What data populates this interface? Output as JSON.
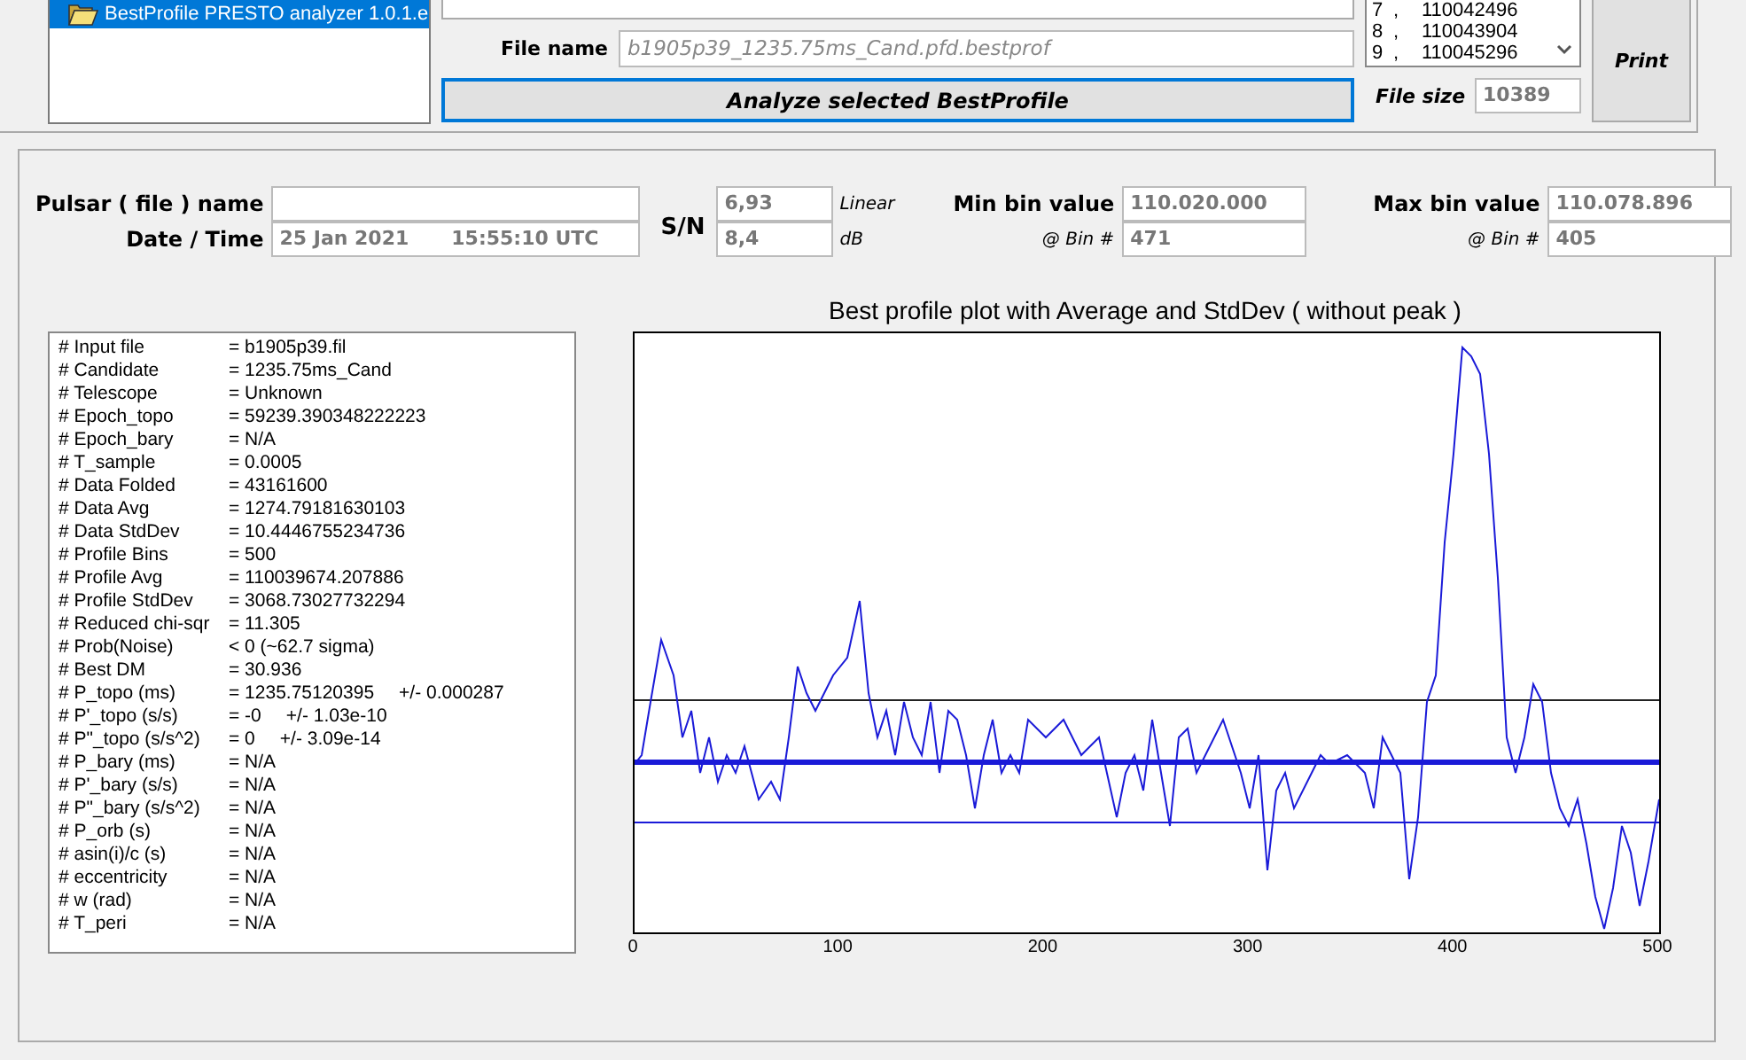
{
  "file_tree": {
    "items": [
      {
        "label": "BestProfile PRESTO analyzer 1.0.1.e",
        "selected": true
      }
    ]
  },
  "file_name": {
    "label": "File name",
    "value": "b1905p39_1235.75ms_Cand.pfd.bestprof"
  },
  "analyze_button": "Analyze selected BestProfile",
  "bin_list": {
    "rows": [
      {
        "index": "7",
        "sep": ",",
        "value": "110042496"
      },
      {
        "index": "8",
        "sep": ",",
        "value": "110043904"
      },
      {
        "index": "9",
        "sep": ",",
        "value": "110045296"
      }
    ]
  },
  "file_size": {
    "label": "File size",
    "value": "10389"
  },
  "print_button": "Print",
  "pulsar_name": {
    "label": "Pulsar ( file ) name"
  },
  "date_time": {
    "label": "Date / Time",
    "date": "25 Jan 2021",
    "time": "15:55:10  UTC"
  },
  "sn": {
    "label": "S/N",
    "linear": "6,93",
    "linear_unit": "Linear",
    "db": "8,4",
    "db_unit": "dB"
  },
  "min_bin": {
    "label": "Min bin value",
    "value": "110.020.000",
    "bin_label": "@ Bin #",
    "bin": "471"
  },
  "max_bin": {
    "label": "Max bin value",
    "value": "110.078.896",
    "bin_label": "@ Bin #",
    "bin": "405"
  },
  "header_info": [
    {
      "key": "# Input file",
      "value": "=  b1905p39.fil"
    },
    {
      "key": "# Candidate",
      "value": "=  1235.75ms_Cand"
    },
    {
      "key": "# Telescope",
      "value": "=  Unknown"
    },
    {
      "key": "# Epoch_topo",
      "value": "=  59239.390348222223"
    },
    {
      "key": "# Epoch_bary",
      "value": "=  N/A"
    },
    {
      "key": "# T_sample",
      "value": "=  0.0005"
    },
    {
      "key": "# Data Folded",
      "value": "=  43161600"
    },
    {
      "key": "# Data Avg",
      "value": "=  1274.79181630103"
    },
    {
      "key": "# Data StdDev",
      "value": "=  10.4446755234736"
    },
    {
      "key": "# Profile Bins",
      "value": "=  500"
    },
    {
      "key": "# Profile Avg",
      "value": "=  110039674.207886"
    },
    {
      "key": "# Profile StdDev",
      "value": "=  3068.73027732294"
    },
    {
      "key": "# Reduced chi-sqr",
      "value": "=  11.305"
    },
    {
      "key": "# Prob(Noise)",
      "value": "<  0   (~62.7 sigma)"
    },
    {
      "key": "# Best DM",
      "value": "=  30.936"
    },
    {
      "key": "# P_topo (ms)",
      "value": "=  1235.75120395",
      "error": "+/- 0.000287"
    },
    {
      "key": "# P'_topo (s/s)",
      "value": "=  -0",
      "error": "+/- 1.03e-10"
    },
    {
      "key": "# P\"_topo (s/s^2)",
      "value": "=  0",
      "error": "+/- 3.09e-14"
    },
    {
      "key": "# P_bary (ms)",
      "value": "=  N/A"
    },
    {
      "key": "# P'_bary (s/s)",
      "value": "=  N/A"
    },
    {
      "key": "# P\"_bary (s/s^2)",
      "value": "=  N/A"
    },
    {
      "key": "# P_orb (s)",
      "value": "=  N/A"
    },
    {
      "key": "# asin(i)/c (s)",
      "value": "=  N/A"
    },
    {
      "key": "# eccentricity",
      "value": "=  N/A"
    },
    {
      "key": "# w (rad)",
      "value": "=  N/A"
    },
    {
      "key": "# T_peri",
      "value": "=  N/A"
    }
  ],
  "chart": {
    "title": "Best profile plot with  Average and StdDev ( without peak )",
    "x_ticks": [
      "0",
      "100",
      "200",
      "300",
      "400",
      "500"
    ]
  }
}
